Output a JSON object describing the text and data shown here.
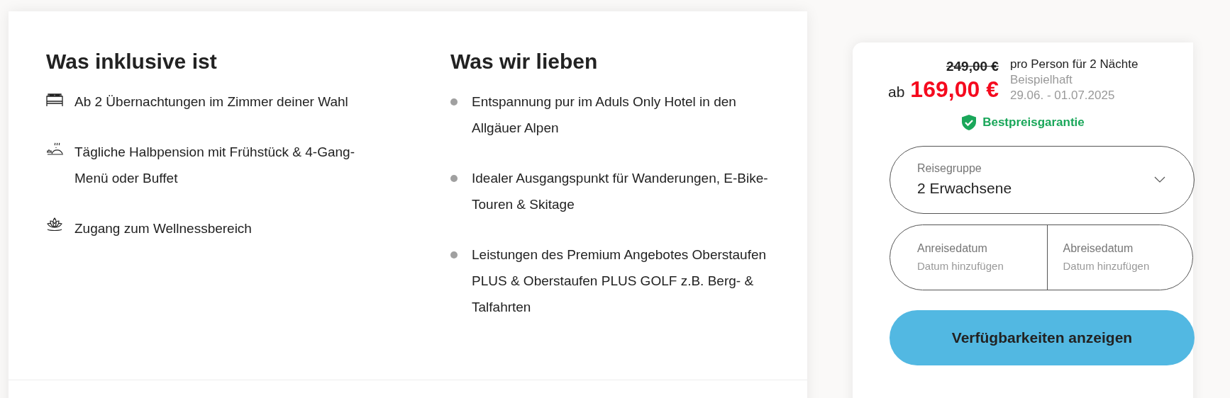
{
  "included": {
    "title": "Was inklusive ist",
    "items": [
      "Ab 2 Übernachtungen im Zimmer deiner Wahl",
      "Tägliche Halbpension mit Frühstück & 4-Gang-Menü oder Buffet",
      "Zugang zum Wellnessbereich"
    ]
  },
  "loved": {
    "title": "Was wir lieben",
    "items": [
      "Entspannung pur im Aduls Only Hotel in den Allgäuer Alpen",
      "Idealer Ausgangspunkt für Wanderungen, E-Bike-Touren & Skitage",
      "Leistungen des Premium Angebotes Oberstaufen PLUS & Oberstaufen PLUS GOLF z.B. Berg- & Talfahrten"
    ]
  },
  "booking": {
    "old_price": "249,00 €",
    "prefix": "ab",
    "price": "169,00 €",
    "per_person": "pro Person für 2 Nächte",
    "note": "Beispielhaft",
    "dates": "29.06. - 01.07.2025",
    "guarantee": "Bestpreisgarantie",
    "group": {
      "label": "Reisegruppe",
      "value": "2 Erwachsene"
    },
    "arrival": {
      "label": "Anreisedatum",
      "placeholder": "Datum hinzufügen"
    },
    "departure": {
      "label": "Abreisedatum",
      "placeholder": "Datum hinzufügen"
    },
    "button": "Verfügbarkeiten anzeigen"
  }
}
